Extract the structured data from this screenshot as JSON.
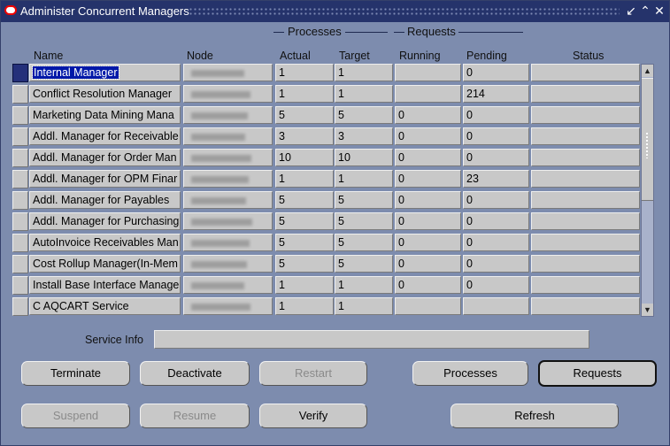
{
  "window": {
    "title": "Administer Concurrent Managers",
    "controls": {
      "minimize": "↙",
      "maximize": "⌃",
      "close": "✕"
    }
  },
  "column_groups": {
    "processes": "Processes",
    "requests": "Requests"
  },
  "columns": {
    "name": "Name",
    "node": "Node",
    "actual": "Actual",
    "target": "Target",
    "running": "Running",
    "pending": "Pending",
    "status": "Status"
  },
  "rows": [
    {
      "name": "Internal Manager",
      "actual": "1",
      "target": "1",
      "running": "",
      "pending": "0",
      "status": "",
      "selected": true
    },
    {
      "name": "Conflict Resolution Manager",
      "actual": "1",
      "target": "1",
      "running": "",
      "pending": "214",
      "status": ""
    },
    {
      "name": "Marketing Data Mining Mana",
      "actual": "5",
      "target": "5",
      "running": "0",
      "pending": "0",
      "status": ""
    },
    {
      "name": "Addl. Manager for Receivable",
      "actual": "3",
      "target": "3",
      "running": "0",
      "pending": "0",
      "status": ""
    },
    {
      "name": "Addl. Manager for Order Man",
      "actual": "10",
      "target": "10",
      "running": "0",
      "pending": "0",
      "status": ""
    },
    {
      "name": "Addl. Manager for OPM Finar",
      "actual": "1",
      "target": "1",
      "running": "0",
      "pending": "23",
      "status": ""
    },
    {
      "name": "Addl. Manager for Payables",
      "actual": "5",
      "target": "5",
      "running": "0",
      "pending": "0",
      "status": ""
    },
    {
      "name": "Addl. Manager for Purchasing",
      "actual": "5",
      "target": "5",
      "running": "0",
      "pending": "0",
      "status": ""
    },
    {
      "name": "AutoInvoice Receivables Man",
      "actual": "5",
      "target": "5",
      "running": "0",
      "pending": "0",
      "status": ""
    },
    {
      "name": "Cost Rollup Manager(In-Mem",
      "actual": "5",
      "target": "5",
      "running": "0",
      "pending": "0",
      "status": ""
    },
    {
      "name": "Install Base Interface Manage",
      "actual": "1",
      "target": "1",
      "running": "0",
      "pending": "0",
      "status": ""
    },
    {
      "name": "C AQCART Service",
      "actual": "1",
      "target": "1",
      "running": "",
      "pending": "",
      "status": ""
    }
  ],
  "service_info": {
    "label": "Service Info",
    "value": ""
  },
  "buttons": {
    "terminate": "Terminate",
    "deactivate": "Deactivate",
    "restart": "Restart",
    "processes": "Processes",
    "requests": "Requests",
    "suspend": "Suspend",
    "resume": "Resume",
    "verify": "Verify",
    "refresh": "Refresh"
  }
}
